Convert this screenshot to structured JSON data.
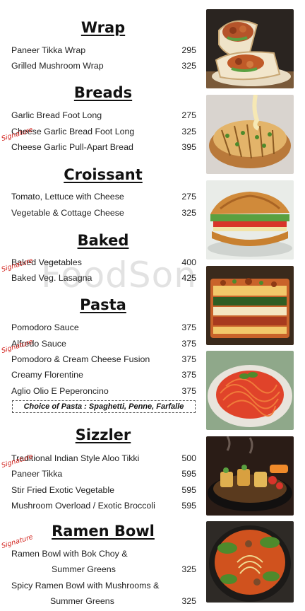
{
  "watermark": "FoodSon",
  "sections": {
    "wrap": {
      "title": "Wrap",
      "items": [
        {
          "name": "Paneer Tikka Wrap",
          "price": "295"
        },
        {
          "name": "Grilled Mushroom Wrap",
          "price": "325"
        }
      ]
    },
    "breads": {
      "title": "Breads",
      "items": [
        {
          "name": "Garlic Bread Foot Long",
          "price": "275"
        },
        {
          "name": "Cheese Garlic Bread Foot Long",
          "price": "325"
        },
        {
          "name": "Cheese Garlic Pull-Apart Bread",
          "price": "395",
          "tag": "Signature"
        }
      ]
    },
    "croissant": {
      "title": "Croissant",
      "items": [
        {
          "name": "Tomato, Lettuce with Cheese",
          "price": "275"
        },
        {
          "name": "Vegetable & Cottage Cheese",
          "price": "325"
        }
      ]
    },
    "baked": {
      "title": "Baked",
      "items": [
        {
          "name": "Baked Vegetables",
          "price": "400"
        },
        {
          "name": "Baked Veg. Lasagna",
          "price": "425",
          "tag": "Signature"
        }
      ]
    },
    "pasta": {
      "title": "Pasta",
      "items": [
        {
          "name": "Pomodoro Sauce",
          "price": "375"
        },
        {
          "name": "Alfredo Sauce",
          "price": "375"
        },
        {
          "name": "Pomodoro & Cream Cheese Fusion",
          "price": "375",
          "tag": "Signature"
        },
        {
          "name": "Creamy Florentine",
          "price": "375"
        },
        {
          "name": "Aglio Olio E Peperoncino",
          "price": "375"
        }
      ],
      "note": "Choice of Pasta : Spaghetti, Penne, Farfalle"
    },
    "sizzler": {
      "title": "Sizzler",
      "items": [
        {
          "name": "Traditional Indian Style Aloo Tikki",
          "price": "500"
        },
        {
          "name": "Paneer Tikka",
          "price": "595",
          "tag": "Signature"
        },
        {
          "name": "Stir Fried Exotic Vegetable",
          "price": "595"
        },
        {
          "name": "Mushroom Overload / Exotic Broccoli",
          "price": "595"
        }
      ]
    },
    "ramen": {
      "title": "Ramen Bowl",
      "items": [
        {
          "name_line1": "Ramen Bowl with Bok Choy &",
          "name_line2": "Summer Greens",
          "price": "325",
          "tag": "Signature"
        },
        {
          "name_line1": "Spicy Ramen Bowl with Mushrooms &",
          "name_line2": "Summer Greens",
          "price": "325"
        }
      ]
    }
  },
  "icons": [
    "wrap-photo",
    "garlic-bread-photo",
    "croissant-sandwich-photo",
    "lasagna-photo",
    "spaghetti-photo",
    "sizzler-photo",
    "ramen-photo"
  ],
  "colors": {
    "signature": "#d2231d",
    "text": "#222222",
    "title": "#111111"
  }
}
